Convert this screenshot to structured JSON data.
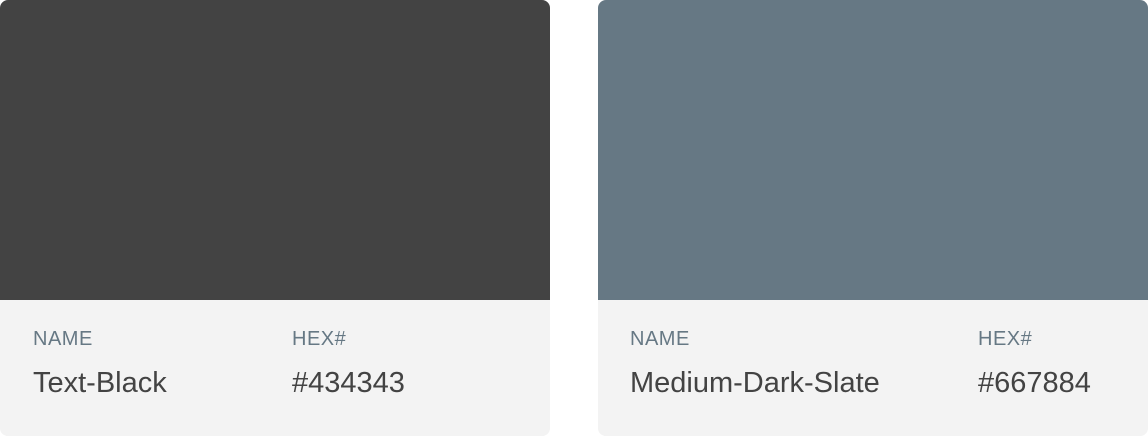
{
  "swatches": [
    {
      "name_label": "NAME",
      "hex_label": "HEX#",
      "name": "Text-Black",
      "hex": "#434343",
      "color": "#434343"
    },
    {
      "name_label": "NAME",
      "hex_label": "HEX#",
      "name": "Medium-Dark-Slate",
      "hex": "#667884",
      "color": "#667884"
    }
  ],
  "colors": {
    "info_background": "#f3f3f3",
    "label_text": "#667884",
    "value_text": "#434343"
  }
}
